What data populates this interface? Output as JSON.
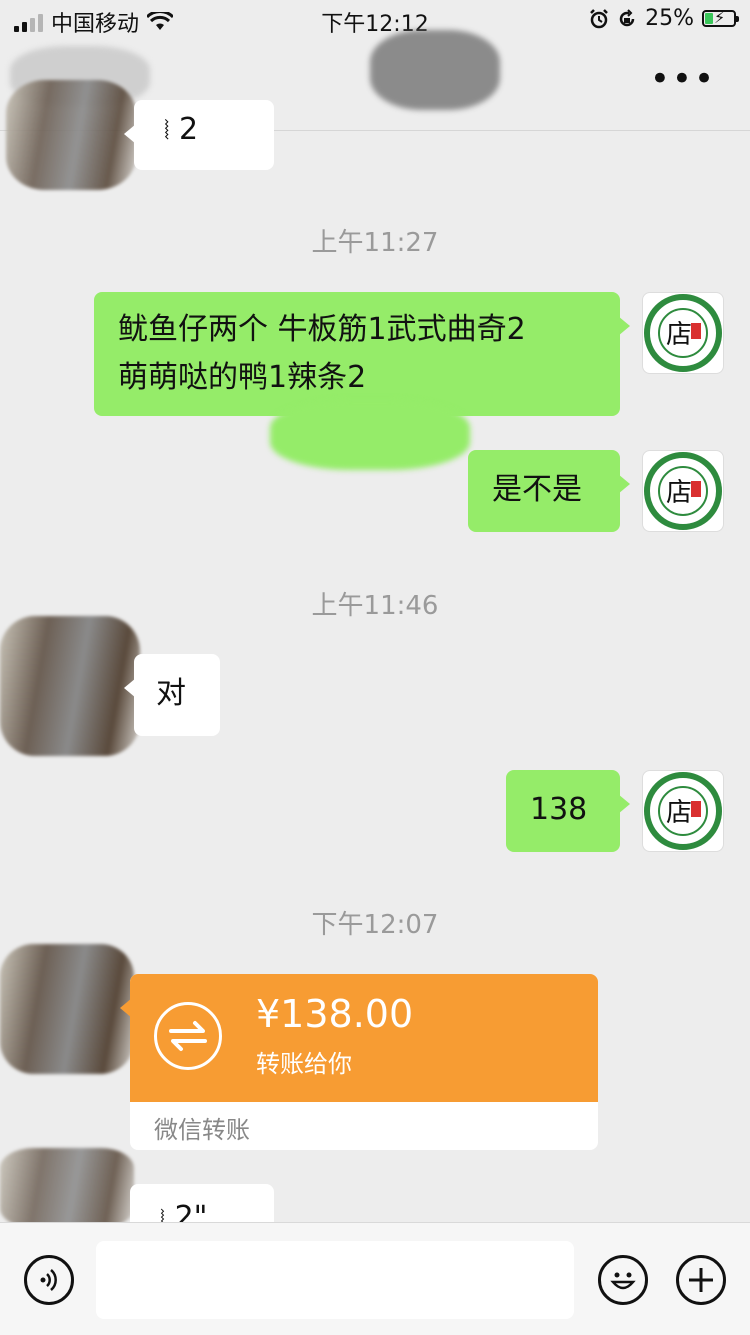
{
  "status_bar": {
    "carrier": "中国移动",
    "time": "下午12:12",
    "battery_percent": "25%",
    "battery_level": 0.25
  },
  "nav": {
    "more": "•••"
  },
  "messages": {
    "partial_top": "2",
    "time1": "上午11:27",
    "m1_line1": "鱿鱼仔两个 牛板筋1武式曲奇2",
    "m1_line2": "萌萌哒的鸭1辣条2",
    "m2": "是不是",
    "time2": "上午11:46",
    "m3": "对",
    "m4": "138",
    "time3": "下午12:07",
    "transfer_amount": "¥138.00",
    "transfer_desc": "转账给你",
    "transfer_footer": "微信转账",
    "partial_bottom": "2\""
  },
  "colors": {
    "green_bubble": "#95ec69",
    "transfer_orange": "#f79c33",
    "background": "#ededed"
  },
  "icons": [
    "wifi-icon",
    "alarm-icon",
    "lock-rotation-icon",
    "more-icon",
    "voice-icon",
    "transfer-arrows-icon",
    "emoji-icon",
    "plus-icon"
  ]
}
